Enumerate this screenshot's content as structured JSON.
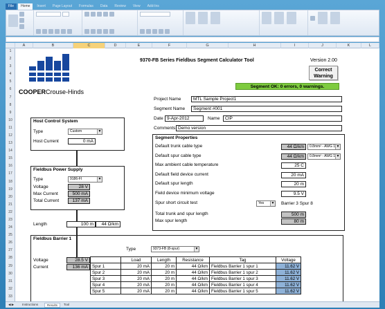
{
  "ribbon": {
    "tabs": [
      "File",
      "Home",
      "Insert",
      "Page Layout",
      "Formulas",
      "Data",
      "Review",
      "View",
      "Add-Ins"
    ]
  },
  "columns": [
    "A",
    "B",
    "C",
    "D",
    "E",
    "F",
    "G",
    "H",
    "I",
    "J",
    "K",
    "L"
  ],
  "rows": [
    "1",
    "2",
    "3",
    "4",
    "5",
    "6",
    "7",
    "8",
    "9",
    "10",
    "11",
    "12",
    "13",
    "14",
    "15",
    "16",
    "17",
    "18",
    "19",
    "20",
    "21",
    "22",
    "23",
    "24",
    "25",
    "26",
    "27",
    "28",
    "29",
    "30",
    "31",
    "32",
    "33"
  ],
  "header": {
    "title": "9370-FB Series Fieldbus Segment Calculator Tool",
    "version": "Version 2.00",
    "correct_line1": "Correct",
    "correct_line2": "Warning",
    "status": "Segment OK: 0 errors, 0 warnings.",
    "brand_cooper": "COOPER",
    "brand_ch": "Crouse-Hinds"
  },
  "project": {
    "project_name_label": "Project Name",
    "project_name_value": "MTL Sample Project1",
    "segment_name_label": "Segment Name",
    "segment_name_value": "Segment #001",
    "date_label": "Date",
    "date_value": "9-Apr-2012",
    "name_label": "Name",
    "name_value": "CIP",
    "comments_label": "Comments",
    "comments_value": "Demo version"
  },
  "host": {
    "title": "Host Control System",
    "type_label": "Type",
    "type_value": "Custom",
    "current_label": "Host Current",
    "current_value": "0 mA"
  },
  "psu": {
    "title": "Fieldbus Power Supply",
    "type_label": "Type",
    "type_value": "9186-FI",
    "voltage_label": "Voltage",
    "voltage_value": "28 V",
    "max_current_label": "Max Current",
    "max_current_value": "500 mA",
    "total_current_label": "Total Current",
    "total_current_value": "137 mA"
  },
  "trunk": {
    "length_label": "Length",
    "length_value": "100 m",
    "resistance_value": "44 Ω/km"
  },
  "segment_props": {
    "title": "Segment Properties",
    "rows": [
      {
        "label": "Default trunk cable type",
        "value": "44 Ω/km",
        "gray": true,
        "dd": "0.8mm² - AWG 18"
      },
      {
        "label": "Default spur cable type",
        "value": "44 Ω/km",
        "gray": true,
        "dd": "0.8mm² - AWG 18"
      },
      {
        "label": "Max ambient cable temperature",
        "value": "25 C",
        "gray": false,
        "dd": ""
      },
      {
        "label": "Default field device current",
        "value": "20 mA",
        "gray": false,
        "dd": ""
      },
      {
        "label": "Default spur length",
        "value": "20 m",
        "gray": false,
        "dd": ""
      },
      {
        "label": "Field device minimum voltage",
        "value": "9.5 V",
        "gray": false,
        "dd": ""
      }
    ],
    "spur_short_label": "Spur short circuit test",
    "spur_short_value": "Yes",
    "spur_short_note": "Barrier 3 Spur 8",
    "total_trunk_label": "Total trunk and spur length",
    "total_trunk_value": "500 m",
    "max_spur_label": "Max spur length",
    "max_spur_value": "80 m"
  },
  "barrier": {
    "title": "Fieldbus Barrier 1",
    "type_label": "Type",
    "type_value": "9373-FB (8-spur)",
    "voltage_label": "Voltage",
    "voltage_value": "28.5 V",
    "current_label": "Current",
    "current_value": "136 mA",
    "headers": [
      "",
      "Load",
      "Length",
      "Resistance",
      "Tag",
      "Voltage"
    ],
    "spurs": [
      {
        "name": "Spur 1",
        "load": "20 mA",
        "length": "20 m",
        "res": "44 Ω/km",
        "tag": "Fieldbus Barrier 1 spur 1",
        "voltage": "11.62 V"
      },
      {
        "name": "Spur 2",
        "load": "20 mA",
        "length": "20 m",
        "res": "44 Ω/km",
        "tag": "Fieldbus Barrier 1 spur 2",
        "voltage": "11.62 V"
      },
      {
        "name": "Spur 3",
        "load": "20 mA",
        "length": "20 m",
        "res": "44 Ω/km",
        "tag": "Fieldbus Barrier 1 spur 3",
        "voltage": "11.62 V"
      },
      {
        "name": "Spur 4",
        "load": "20 mA",
        "length": "20 m",
        "res": "44 Ω/km",
        "tag": "Fieldbus Barrier 1 spur 4",
        "voltage": "11.62 V"
      },
      {
        "name": "Spur 5",
        "load": "20 mA",
        "length": "20 m",
        "res": "44 Ω/km",
        "tag": "Fieldbus Barrier 1 spur 5",
        "voltage": "11.62 V"
      }
    ]
  },
  "sheet_tabs": [
    "Instructions",
    "Results",
    "Tool"
  ],
  "colors": {
    "logo_blue": "#17479e",
    "status_green": "#7ecb3f",
    "voltage_blue": "#8fb2d8",
    "input_gray": "#c3c3c3"
  }
}
